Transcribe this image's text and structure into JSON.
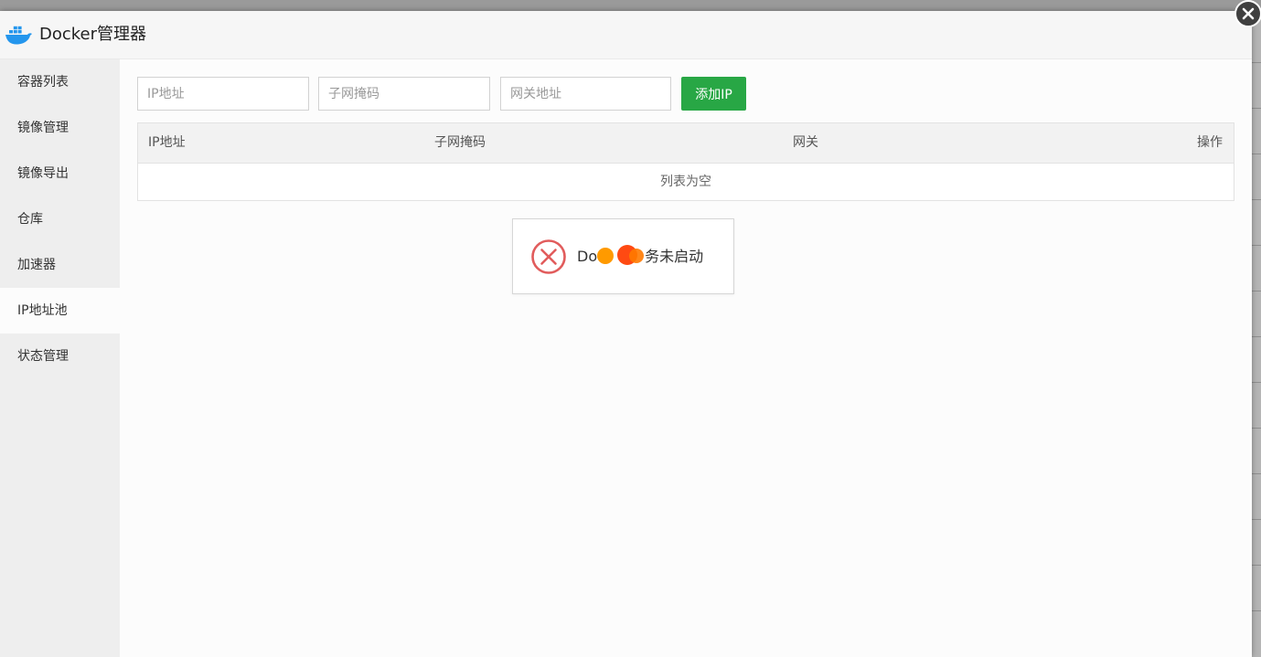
{
  "window": {
    "title": "Docker管理器",
    "app_icon": "docker-whale-icon",
    "close_icon": "close-icon"
  },
  "sidebar": {
    "items": [
      {
        "label": "容器列表"
      },
      {
        "label": "镜像管理"
      },
      {
        "label": "镜像导出"
      },
      {
        "label": "仓库"
      },
      {
        "label": "加速器"
      },
      {
        "label": "IP地址池",
        "active": true
      },
      {
        "label": "状态管理"
      }
    ]
  },
  "form": {
    "ip_placeholder": "IP地址",
    "subnet_placeholder": "子网掩码",
    "gateway_placeholder": "网关地址",
    "add_button": "添加IP"
  },
  "table": {
    "columns": [
      "IP地址",
      "子网掩码",
      "网关",
      "操作"
    ],
    "empty_text": "列表为空"
  },
  "toast": {
    "text_prefix": "Do",
    "text_suffix": "务未启动",
    "icon": "error-circle-icon"
  },
  "colors": {
    "accent_green": "#28a745",
    "error_red": "#e15c5c",
    "redaction_orange": "#ff9900",
    "redaction_red": "#ff4a12"
  }
}
